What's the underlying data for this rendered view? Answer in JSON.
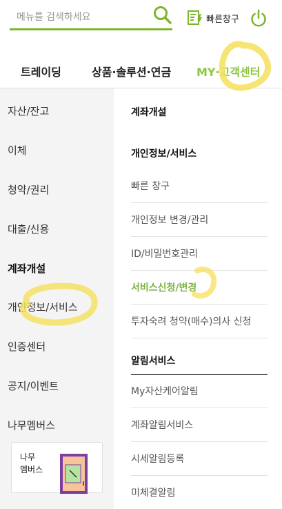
{
  "search": {
    "placeholder": "메뉴를 검색하세요",
    "value": ""
  },
  "quick_account": {
    "label": "빠른창구"
  },
  "tabs": [
    {
      "label": "트레이딩",
      "active": false
    },
    {
      "label": "상품·솔루션·연금",
      "active": false
    },
    {
      "label": "MY·고객센터",
      "active": true
    }
  ],
  "sidebar": {
    "items": [
      {
        "label": "자산/잔고"
      },
      {
        "label": "이체"
      },
      {
        "label": "청약/권리"
      },
      {
        "label": "대출/신용"
      },
      {
        "label": "계좌개설"
      },
      {
        "label": "개인정보/서비스"
      },
      {
        "label": "인증센터"
      },
      {
        "label": "공지/이벤트"
      },
      {
        "label": "나무멤버스"
      }
    ],
    "active_label": "계좌개설",
    "promo": {
      "text": "나무\n멤버스"
    }
  },
  "submenu": {
    "section_account": "계좌개설",
    "section_personal": "개인정보/서비스",
    "personal_items": [
      {
        "label": "빠른 창구"
      },
      {
        "label": "개인정보 변경/관리"
      },
      {
        "label": "ID/비밀번호관리"
      },
      {
        "label": "서비스신청/변경"
      },
      {
        "label": "투자숙려 청약(매수)의사 신청"
      }
    ],
    "section_alert": "알림서비스",
    "alert_items": [
      {
        "label": "My자산케어알림"
      },
      {
        "label": "계좌알림서비스"
      },
      {
        "label": "시세알림등록"
      },
      {
        "label": "미체결알림"
      }
    ]
  },
  "colors": {
    "accent": "#8cc63f",
    "highlighter": "#f5e05a",
    "sidebar_bg": "#f4f4f4"
  }
}
